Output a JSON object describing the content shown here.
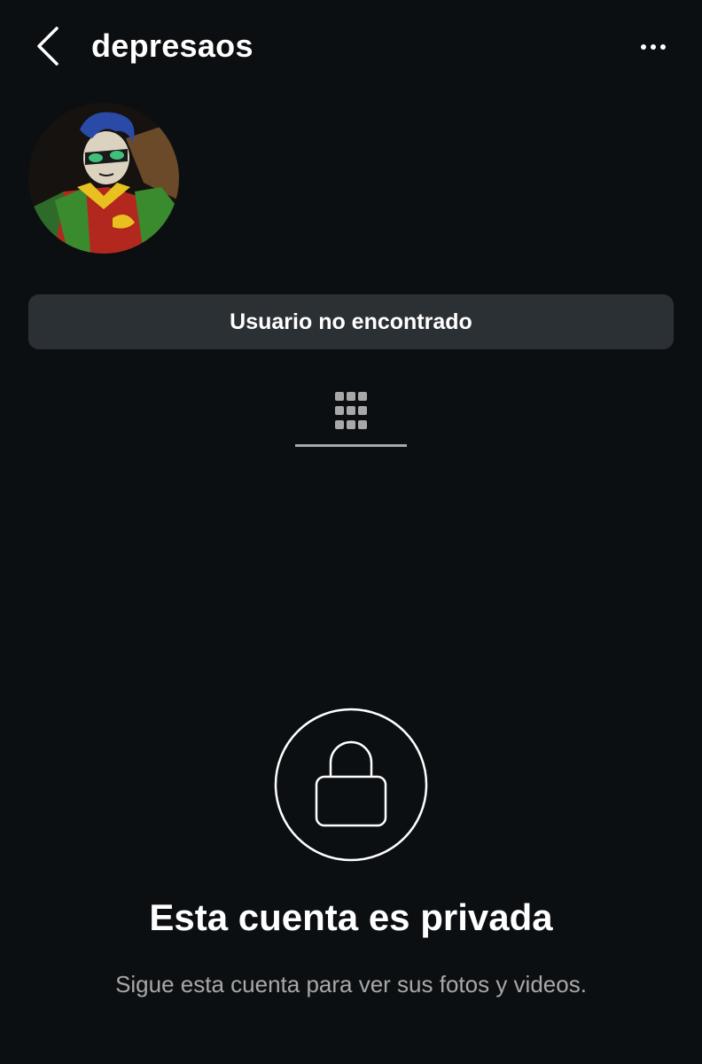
{
  "header": {
    "username": "depresaos",
    "back_icon": "chevron-left-icon",
    "more_icon": "more-horizontal-icon"
  },
  "profile": {
    "avatar_icon": "avatar-image",
    "status_button_label": "Usuario no encontrado"
  },
  "tabs": {
    "grid_icon": "grid-icon",
    "active": "grid"
  },
  "private_notice": {
    "icon": "lock-icon",
    "title": "Esta cuenta es privada",
    "subtitle": "Sigue esta cuenta para ver sus fotos y videos."
  },
  "colors": {
    "background": "#0c0f12",
    "button_bg": "#2b3035",
    "secondary_text": "#a8a8a8",
    "primary_text": "#ffffff"
  }
}
